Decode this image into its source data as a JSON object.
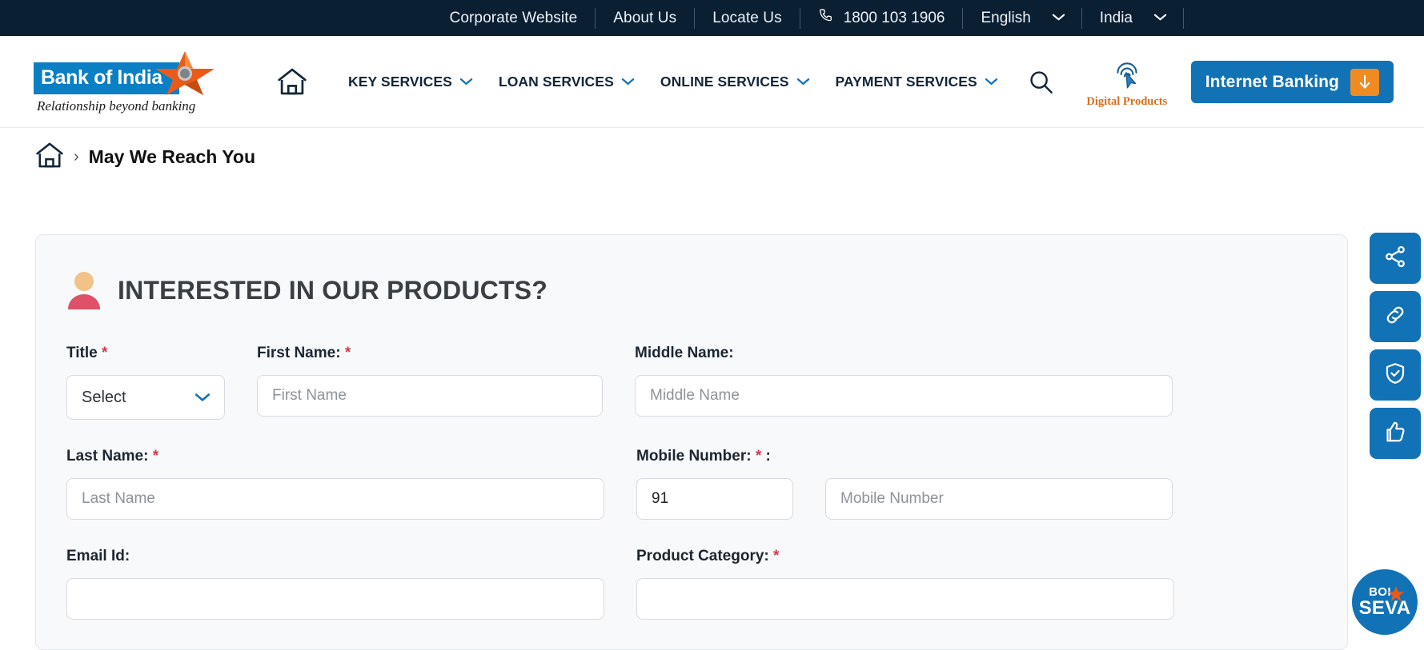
{
  "topbar": {
    "links": [
      "Corporate Website",
      "About Us",
      "Locate Us"
    ],
    "phone": "1800 103 1906",
    "phone_icon": "phone-icon",
    "language": "English",
    "country": "India"
  },
  "header": {
    "logo_text": "Bank of India",
    "logo_tagline": "Relationship beyond banking",
    "home_icon": "home-icon",
    "nav": [
      {
        "label": "KEY SERVICES",
        "icon": "chevron-down-icon"
      },
      {
        "label": "LOAN SERVICES",
        "icon": "chevron-down-icon"
      },
      {
        "label": "ONLINE SERVICES",
        "icon": "chevron-down-icon"
      },
      {
        "label": "PAYMENT SERVICES",
        "icon": "chevron-down-icon"
      }
    ],
    "search_icon": "search-icon",
    "digital_products_label": "Digital Products",
    "digital_products_icon": "tap-cursor-icon",
    "internet_banking_label": "Internet Banking",
    "internet_banking_icon": "arrow-down-icon",
    "accent_blue": "#1272b6",
    "accent_orange": "#f08b23"
  },
  "breadcrumb": {
    "home_icon": "home-icon",
    "separator": "›",
    "current": "May We Reach You"
  },
  "form": {
    "title": "INTERESTED IN OUR PRODUCTS?",
    "title_icon": "user-avatar-icon",
    "fields": {
      "title_label": "Title",
      "title_value": "Select",
      "title_required": "*",
      "first_name_label": "First Name:",
      "first_name_placeholder": "First Name",
      "first_name_value": "",
      "first_name_required": "*",
      "middle_name_label": "Middle Name:",
      "middle_name_placeholder": "Middle Name",
      "middle_name_value": "",
      "last_name_label": "Last Name:",
      "last_name_placeholder": "Last Name",
      "last_name_value": "",
      "last_name_required": "*",
      "mobile_label": "Mobile Number:",
      "mobile_required": "*",
      "mobile_label_suffix": ":",
      "country_code_value": "91",
      "mobile_placeholder": "Mobile Number",
      "mobile_value": "",
      "email_label": "Email Id:",
      "product_category_label": "Product Category:",
      "product_category_required": "*"
    }
  },
  "rail": {
    "buttons": [
      {
        "icon": "share-icon"
      },
      {
        "icon": "link-icon"
      },
      {
        "icon": "shield-check-icon"
      },
      {
        "icon": "thumbs-up-icon"
      }
    ]
  },
  "seva": {
    "line1": "BOI",
    "line2": "SEVA",
    "icon": "star-icon"
  }
}
